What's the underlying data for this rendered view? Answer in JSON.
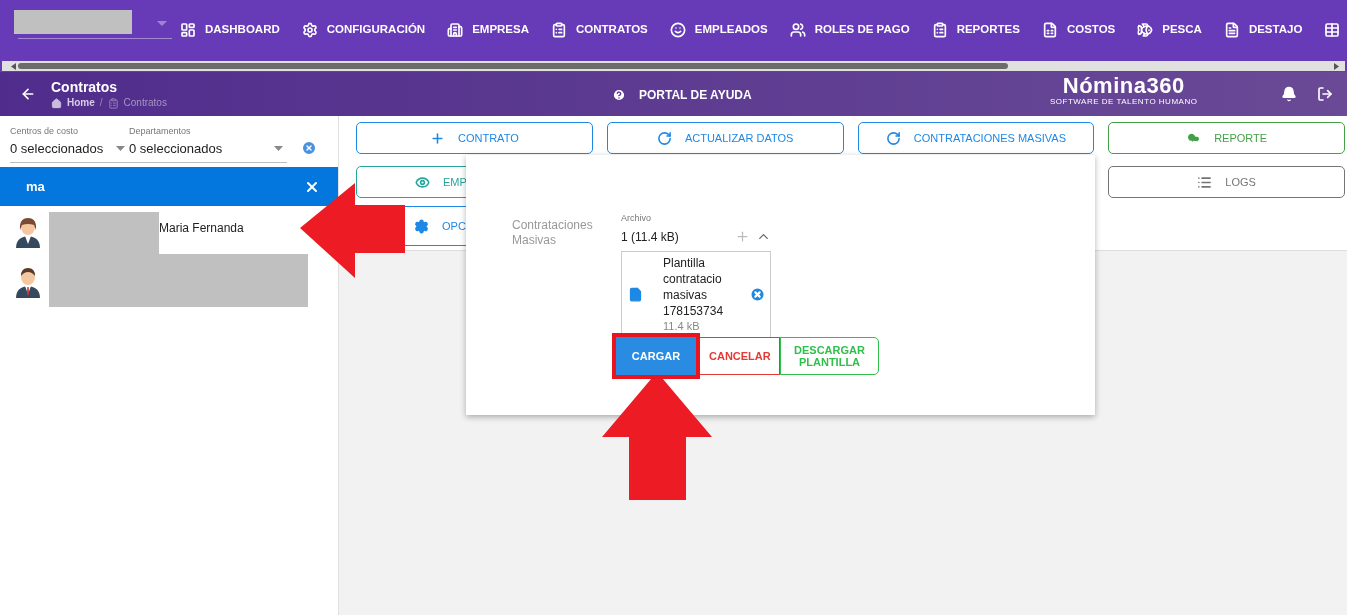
{
  "top_nav": {
    "items": [
      {
        "kind": "dashboard",
        "label": "DASHBOARD"
      },
      {
        "kind": "gear",
        "label": "CONFIGURACIÓN"
      },
      {
        "kind": "building",
        "label": "EMPRESA"
      },
      {
        "kind": "clipboard",
        "label": "CONTRATOS"
      },
      {
        "kind": "face",
        "label": "EMPLEADOS"
      },
      {
        "kind": "users",
        "label": "ROLES DE PAGO"
      },
      {
        "kind": "clipboard",
        "label": "REPORTES"
      },
      {
        "kind": "invoice",
        "label": "COSTOS"
      },
      {
        "kind": "fish",
        "label": "PESCA"
      },
      {
        "kind": "document",
        "label": "DESTAJO"
      },
      {
        "kind": "table"
      }
    ]
  },
  "header": {
    "title": "Contratos",
    "breadcrumb": [
      "Home",
      "/",
      "Contratos"
    ],
    "help": "PORTAL DE AYUDA",
    "logo": {
      "name": "Nómina360",
      "tagline": "SOFTWARE DE TALENTO HUMANO"
    }
  },
  "filters": [
    {
      "label": "Centros de costo",
      "value": "0 seleccionados"
    },
    {
      "label": "Departamentos",
      "value": "0 seleccionados"
    }
  ],
  "search": {
    "value": "ma"
  },
  "employees": [
    {
      "kind": "female",
      "name": "Maria Fernanda"
    },
    {
      "kind": "male"
    }
  ],
  "actions": [
    {
      "kind": "plus",
      "label": "CONTRATO",
      "color": "#1e88e5"
    },
    {
      "kind": "refresh",
      "label": "ACTUALIZAR DATOS",
      "color": "#1e88e5"
    },
    {
      "kind": "refresh",
      "label": "CONTRATACIONES MASIVAS",
      "color": "#1e88e5"
    },
    {
      "kind": "cloud",
      "label": "REPORTE",
      "color": "#43a047"
    },
    {
      "kind": "eye",
      "label": "EMP",
      "color": "#26a69a"
    },
    {
      "kind": "list",
      "label": "LOGS",
      "color": "#757575"
    },
    {
      "kind": "gear",
      "label": "OPC",
      "color": "#1e88e5"
    }
  ],
  "dialog": {
    "label": "Contrataciones Masivas",
    "field_label": "Archivo",
    "summary": "1 (11.4 kB)",
    "file": {
      "name": "Plantilla contratacio masivas 178153734",
      "size": "11.4 kB"
    },
    "buttons": [
      {
        "kind": "primary",
        "label": "CARGAR",
        "highlighted": true
      },
      {
        "kind": "danger",
        "label": "CANCELAR",
        "highlighted": false
      },
      {
        "kind": "success",
        "label": "DESCARGAR PLANTILLA",
        "highlighted": false
      }
    ]
  }
}
